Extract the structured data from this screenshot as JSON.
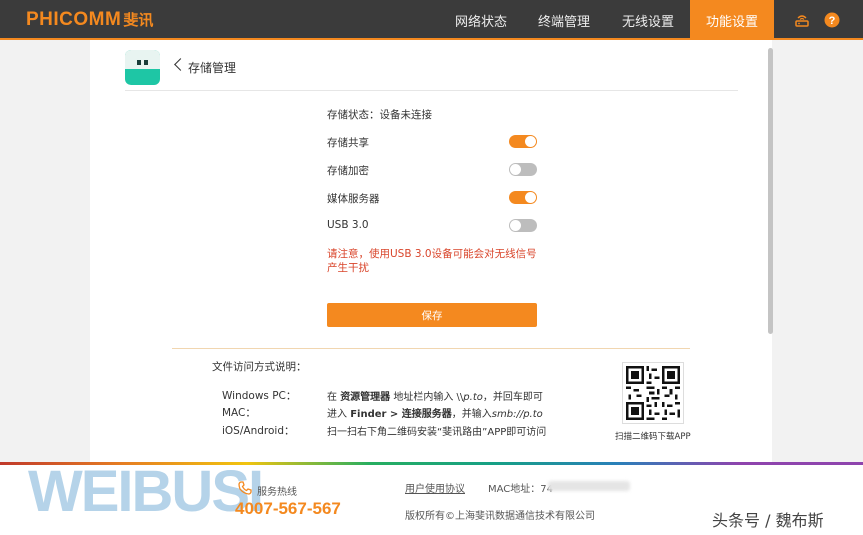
{
  "header": {
    "logo_en": "PHICOMM",
    "logo_cn": "斐讯",
    "nav": [
      "网络状态",
      "终端管理",
      "无线设置",
      "功能设置"
    ],
    "active_nav": "功能设置"
  },
  "page": {
    "title": "存储管理",
    "status_label": "存储状态：设备未连接",
    "settings": [
      {
        "label": "存储共享",
        "on": true
      },
      {
        "label": "存储加密",
        "on": false
      },
      {
        "label": "媒体服务器",
        "on": true
      },
      {
        "label": "USB 3.0",
        "on": false
      }
    ],
    "warning": "请注意，使用USB 3.0设备可能会对无线信号产生干扰",
    "save_label": "保存"
  },
  "access": {
    "title": "文件访问方式说明：",
    "windows": {
      "os": "Windows PC：",
      "pre": "在 ",
      "bold": "资源管理器",
      "mid": " 地址栏内输入 \\\\",
      "ital": "p.to",
      "post": "，并回车即可"
    },
    "mac": {
      "os": "MAC：",
      "pre": "进入 ",
      "bold": "Finder > 连接服务器",
      "mid": "，并输入",
      "ital": "smb://p.to",
      "post": ""
    },
    "ios": {
      "os": "iOS/Android：",
      "text": "扫一扫右下角二维码安装“斐讯路由”APP即可访问"
    },
    "qr_caption": "扫描二维码下载APP"
  },
  "footer": {
    "hotline_label": "服务热线",
    "hotline_number": "4007-567-567",
    "user_agreement": "用户使用协议",
    "mac_label": "MAC地址：74",
    "copyright": "版权所有©上海斐讯数据通信技术有限公司"
  },
  "watermark": "WEIBUSI",
  "byline": "头条号 / 魏布斯",
  "colors": {
    "accent": "#f4891f",
    "header_bg": "#3b3b3b",
    "warning": "#d9452b",
    "toggle_off": "#bdbdbd"
  }
}
